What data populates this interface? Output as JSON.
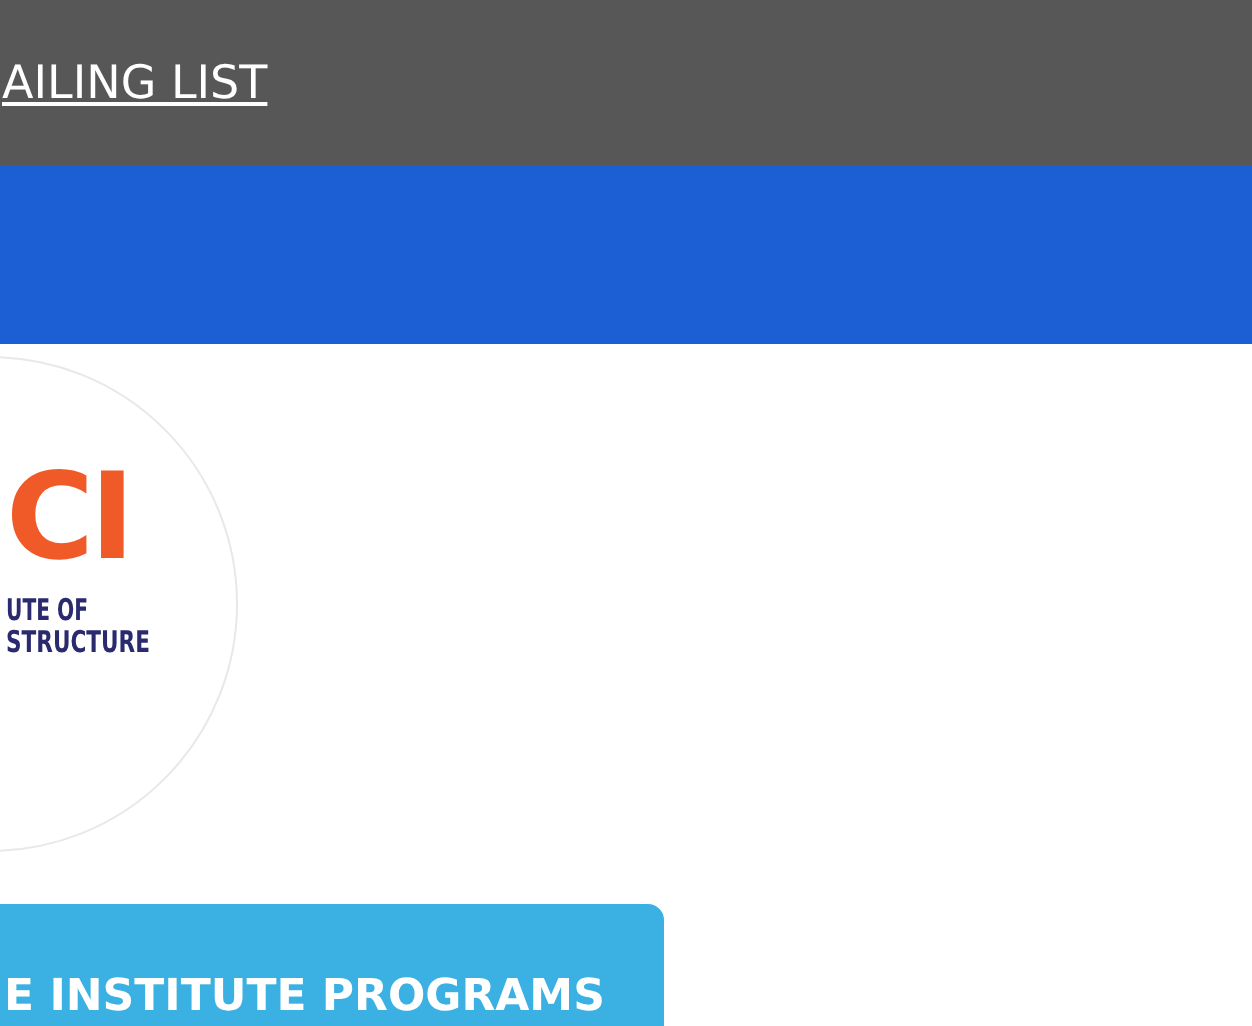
{
  "top_bar": {
    "link": "AILING LIST"
  },
  "logo": {
    "letters": "CI",
    "line_1": "UTE OF",
    "line_2": "STRUCTURE"
  },
  "programs_button": {
    "label": "E INSTITUTE PROGRAMS"
  }
}
